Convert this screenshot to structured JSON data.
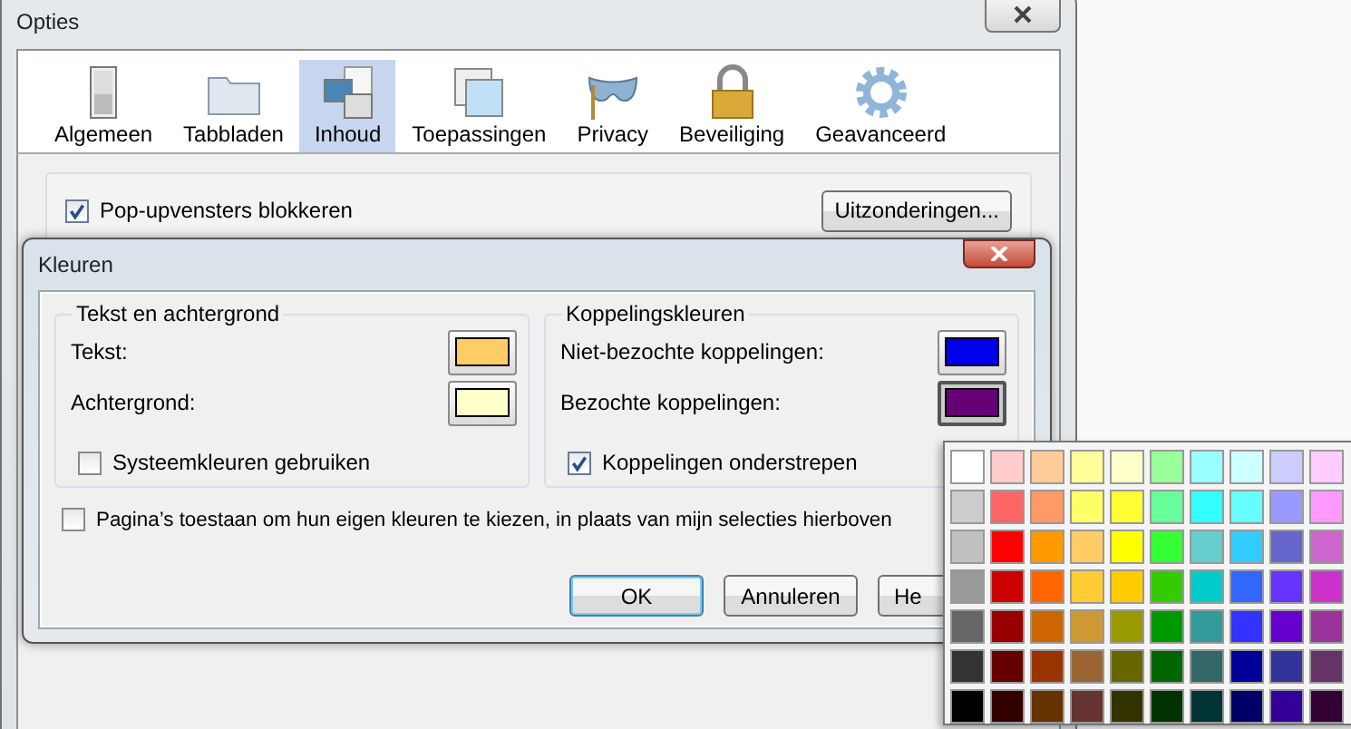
{
  "window": {
    "title": "Opties"
  },
  "tabs": [
    {
      "label": "Algemeen",
      "selected": false
    },
    {
      "label": "Tabbladen",
      "selected": false
    },
    {
      "label": "Inhoud",
      "selected": true
    },
    {
      "label": "Toepassingen",
      "selected": false
    },
    {
      "label": "Privacy",
      "selected": false
    },
    {
      "label": "Beveiliging",
      "selected": false
    },
    {
      "label": "Geavanceerd",
      "selected": false
    }
  ],
  "popup": {
    "label": "Pop-upvensters blokkeren",
    "checked": true,
    "button": "Uitzonderingen..."
  },
  "dialog": {
    "title": "Kleuren",
    "groups": [
      {
        "title": "Tekst en achtergrond",
        "rows": [
          {
            "label": "Tekst:",
            "color": "#ffcc66",
            "pressed": false
          },
          {
            "label": "Achtergrond:",
            "color": "#ffffcc",
            "pressed": false
          }
        ],
        "checkbox": {
          "label": "Systeemkleuren gebruiken",
          "checked": false
        }
      },
      {
        "title": "Koppelingskleuren",
        "rows": [
          {
            "label": "Niet-bezochte koppelingen:",
            "color": "#0000ee",
            "pressed": false
          },
          {
            "label": "Bezochte koppelingen:",
            "color": "#660077",
            "pressed": true
          }
        ],
        "checkbox": {
          "label": "Koppelingen onderstrepen",
          "checked": true
        }
      }
    ],
    "allow": {
      "label": "Pagina’s toestaan om hun eigen kleuren te kiezen, in plaats van mijn selecties hierboven",
      "checked": false
    },
    "buttons": [
      {
        "label": "OK",
        "default": true
      },
      {
        "label": "Annuleren",
        "default": false
      },
      {
        "label": "He",
        "default": false
      }
    ]
  },
  "palette": [
    [
      {
        "color": "#ffffff"
      },
      {
        "color": "#ffcccc"
      },
      {
        "color": "#ffcc99"
      },
      {
        "color": "#ffff99"
      },
      {
        "color": "#ffffcc"
      },
      {
        "color": "#99ff99"
      },
      {
        "color": "#99ffff"
      },
      {
        "color": "#ccffff"
      },
      {
        "color": "#ccccff"
      },
      {
        "color": "#ffccff"
      }
    ],
    [
      {
        "color": "#cccccc"
      },
      {
        "color": "#ff6666"
      },
      {
        "color": "#ff9966"
      },
      {
        "color": "#ffff66"
      },
      {
        "color": "#ffff33"
      },
      {
        "color": "#66ff99"
      },
      {
        "color": "#33ffff"
      },
      {
        "color": "#66ffff"
      },
      {
        "color": "#9999ff"
      },
      {
        "color": "#ff99ff"
      }
    ],
    [
      {
        "color": "#c0c0c0"
      },
      {
        "color": "#ff0000"
      },
      {
        "color": "#ff9900"
      },
      {
        "color": "#ffcc66"
      },
      {
        "color": "#ffff00"
      },
      {
        "color": "#33ff33"
      },
      {
        "color": "#66cccc"
      },
      {
        "color": "#33ccff"
      },
      {
        "color": "#6666cc"
      },
      {
        "color": "#cc66cc"
      }
    ],
    [
      {
        "color": "#999999"
      },
      {
        "color": "#cc0000"
      },
      {
        "color": "#ff6600"
      },
      {
        "color": "#ffcc33"
      },
      {
        "color": "#ffcc00"
      },
      {
        "color": "#33cc00"
      },
      {
        "color": "#00cccc"
      },
      {
        "color": "#3366ff"
      },
      {
        "color": "#6633ff"
      },
      {
        "color": "#cc33cc"
      }
    ],
    [
      {
        "color": "#666666"
      },
      {
        "color": "#990000"
      },
      {
        "color": "#cc6600"
      },
      {
        "color": "#cc9933"
      },
      {
        "color": "#999900"
      },
      {
        "color": "#009900"
      },
      {
        "color": "#339999"
      },
      {
        "color": "#3333ff"
      },
      {
        "color": "#6600cc"
      },
      {
        "color": "#993399"
      }
    ],
    [
      {
        "color": "#333333"
      },
      {
        "color": "#660000"
      },
      {
        "color": "#993300"
      },
      {
        "color": "#996633"
      },
      {
        "color": "#666600"
      },
      {
        "color": "#006600"
      },
      {
        "color": "#336666"
      },
      {
        "color": "#000099"
      },
      {
        "color": "#333399"
      },
      {
        "color": "#663366"
      }
    ],
    [
      {
        "color": "#000000"
      },
      {
        "color": "#330000"
      },
      {
        "color": "#663300"
      },
      {
        "color": "#663333"
      },
      {
        "color": "#333300"
      },
      {
        "color": "#003300"
      },
      {
        "color": "#003333"
      },
      {
        "color": "#000066"
      },
      {
        "color": "#330099"
      },
      {
        "color": "#330033"
      }
    ]
  ]
}
